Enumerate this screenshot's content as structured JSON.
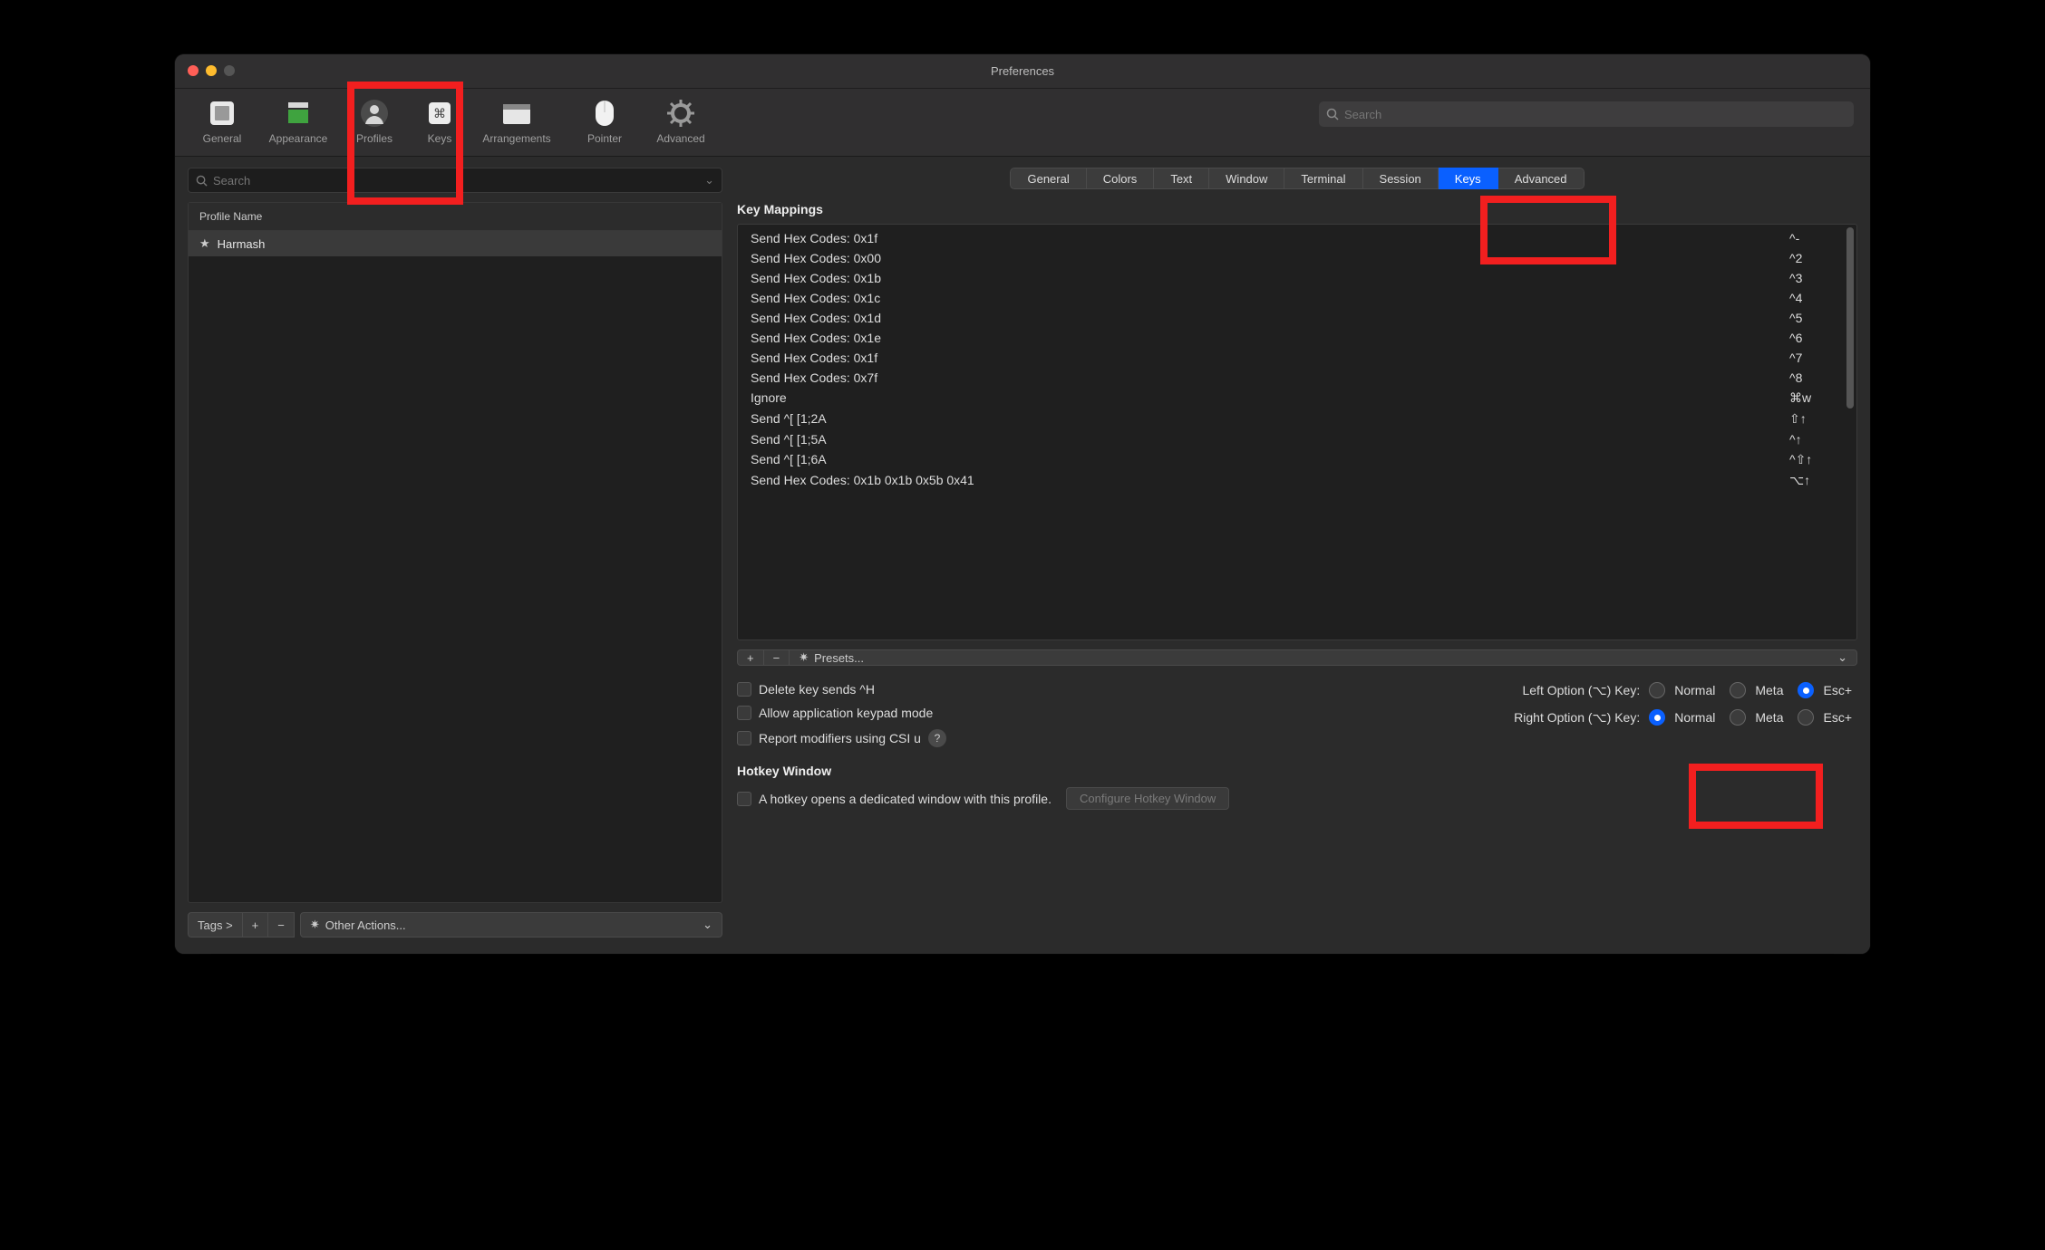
{
  "window": {
    "title": "Preferences"
  },
  "toolbar": {
    "items": [
      {
        "label": "General"
      },
      {
        "label": "Appearance"
      },
      {
        "label": "Profiles"
      },
      {
        "label": "Keys"
      },
      {
        "label": "Arrangements"
      },
      {
        "label": "Pointer"
      },
      {
        "label": "Advanced"
      }
    ],
    "search_placeholder": "Search"
  },
  "sidebar": {
    "search_placeholder": "Search",
    "header": "Profile Name",
    "profiles": [
      {
        "name": "Harmash",
        "starred": true
      }
    ],
    "tags_label": "Tags >",
    "other_actions_label": "Other Actions..."
  },
  "tabs": [
    "General",
    "Colors",
    "Text",
    "Window",
    "Terminal",
    "Session",
    "Keys",
    "Advanced"
  ],
  "active_tab": "Keys",
  "key_mappings_title": "Key Mappings",
  "mappings": [
    {
      "action": "Send Hex Codes: 0x1f",
      "shortcut": "^-"
    },
    {
      "action": "Send Hex Codes: 0x00",
      "shortcut": "^2"
    },
    {
      "action": "Send Hex Codes: 0x1b",
      "shortcut": "^3"
    },
    {
      "action": "Send Hex Codes: 0x1c",
      "shortcut": "^4"
    },
    {
      "action": "Send Hex Codes: 0x1d",
      "shortcut": "^5"
    },
    {
      "action": "Send Hex Codes: 0x1e",
      "shortcut": "^6"
    },
    {
      "action": "Send Hex Codes: 0x1f",
      "shortcut": "^7"
    },
    {
      "action": "Send Hex Codes: 0x7f",
      "shortcut": "^8"
    },
    {
      "action": "Ignore",
      "shortcut": "⌘w"
    },
    {
      "action": "Send ^[ [1;2A",
      "shortcut": "⇧↑"
    },
    {
      "action": "Send ^[ [1;5A",
      "shortcut": "^↑"
    },
    {
      "action": "Send ^[ [1;6A",
      "shortcut": "^⇧↑"
    },
    {
      "action": "Send Hex Codes: 0x1b 0x1b 0x5b 0x41",
      "shortcut": "⌥↑"
    }
  ],
  "presets_label": "Presets...",
  "checkboxes": {
    "delete_h": "Delete key sends ^H",
    "keypad": "Allow application keypad mode",
    "csi_u": "Report modifiers using CSI u"
  },
  "option_keys": {
    "left_label": "Left Option (⌥) Key:",
    "right_label": "Right Option (⌥) Key:",
    "options": [
      "Normal",
      "Meta",
      "Esc+"
    ],
    "left_selected": "Esc+",
    "right_selected": "Normal"
  },
  "hotkey": {
    "title": "Hotkey Window",
    "checkbox": "A hotkey opens a dedicated window with this profile.",
    "button": "Configure Hotkey Window"
  }
}
